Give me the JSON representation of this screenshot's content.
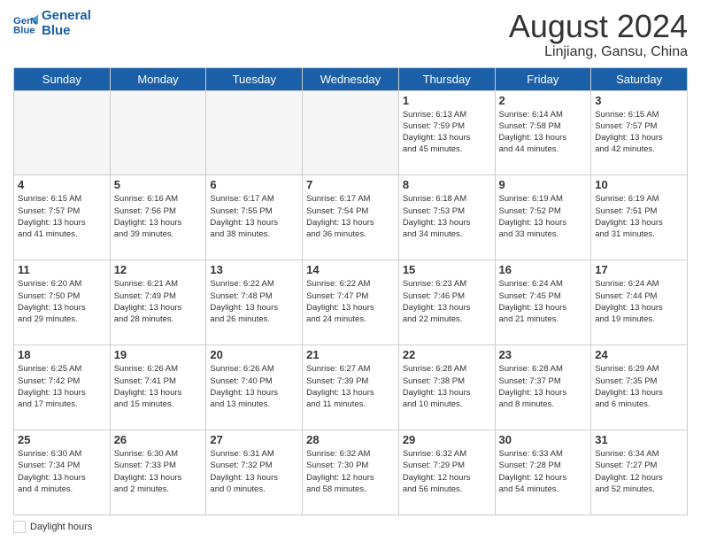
{
  "header": {
    "logo_line1": "General",
    "logo_line2": "Blue",
    "month_year": "August 2024",
    "location": "Linjiang, Gansu, China"
  },
  "weekdays": [
    "Sunday",
    "Monday",
    "Tuesday",
    "Wednesday",
    "Thursday",
    "Friday",
    "Saturday"
  ],
  "weeks": [
    [
      {
        "day": "",
        "info": ""
      },
      {
        "day": "",
        "info": ""
      },
      {
        "day": "",
        "info": ""
      },
      {
        "day": "",
        "info": ""
      },
      {
        "day": "1",
        "info": "Sunrise: 6:13 AM\nSunset: 7:59 PM\nDaylight: 13 hours\nand 45 minutes."
      },
      {
        "day": "2",
        "info": "Sunrise: 6:14 AM\nSunset: 7:58 PM\nDaylight: 13 hours\nand 44 minutes."
      },
      {
        "day": "3",
        "info": "Sunrise: 6:15 AM\nSunset: 7:57 PM\nDaylight: 13 hours\nand 42 minutes."
      }
    ],
    [
      {
        "day": "4",
        "info": "Sunrise: 6:15 AM\nSunset: 7:57 PM\nDaylight: 13 hours\nand 41 minutes."
      },
      {
        "day": "5",
        "info": "Sunrise: 6:16 AM\nSunset: 7:56 PM\nDaylight: 13 hours\nand 39 minutes."
      },
      {
        "day": "6",
        "info": "Sunrise: 6:17 AM\nSunset: 7:55 PM\nDaylight: 13 hours\nand 38 minutes."
      },
      {
        "day": "7",
        "info": "Sunrise: 6:17 AM\nSunset: 7:54 PM\nDaylight: 13 hours\nand 36 minutes."
      },
      {
        "day": "8",
        "info": "Sunrise: 6:18 AM\nSunset: 7:53 PM\nDaylight: 13 hours\nand 34 minutes."
      },
      {
        "day": "9",
        "info": "Sunrise: 6:19 AM\nSunset: 7:52 PM\nDaylight: 13 hours\nand 33 minutes."
      },
      {
        "day": "10",
        "info": "Sunrise: 6:19 AM\nSunset: 7:51 PM\nDaylight: 13 hours\nand 31 minutes."
      }
    ],
    [
      {
        "day": "11",
        "info": "Sunrise: 6:20 AM\nSunset: 7:50 PM\nDaylight: 13 hours\nand 29 minutes."
      },
      {
        "day": "12",
        "info": "Sunrise: 6:21 AM\nSunset: 7:49 PM\nDaylight: 13 hours\nand 28 minutes."
      },
      {
        "day": "13",
        "info": "Sunrise: 6:22 AM\nSunset: 7:48 PM\nDaylight: 13 hours\nand 26 minutes."
      },
      {
        "day": "14",
        "info": "Sunrise: 6:22 AM\nSunset: 7:47 PM\nDaylight: 13 hours\nand 24 minutes."
      },
      {
        "day": "15",
        "info": "Sunrise: 6:23 AM\nSunset: 7:46 PM\nDaylight: 13 hours\nand 22 minutes."
      },
      {
        "day": "16",
        "info": "Sunrise: 6:24 AM\nSunset: 7:45 PM\nDaylight: 13 hours\nand 21 minutes."
      },
      {
        "day": "17",
        "info": "Sunrise: 6:24 AM\nSunset: 7:44 PM\nDaylight: 13 hours\nand 19 minutes."
      }
    ],
    [
      {
        "day": "18",
        "info": "Sunrise: 6:25 AM\nSunset: 7:42 PM\nDaylight: 13 hours\nand 17 minutes."
      },
      {
        "day": "19",
        "info": "Sunrise: 6:26 AM\nSunset: 7:41 PM\nDaylight: 13 hours\nand 15 minutes."
      },
      {
        "day": "20",
        "info": "Sunrise: 6:26 AM\nSunset: 7:40 PM\nDaylight: 13 hours\nand 13 minutes."
      },
      {
        "day": "21",
        "info": "Sunrise: 6:27 AM\nSunset: 7:39 PM\nDaylight: 13 hours\nand 11 minutes."
      },
      {
        "day": "22",
        "info": "Sunrise: 6:28 AM\nSunset: 7:38 PM\nDaylight: 13 hours\nand 10 minutes."
      },
      {
        "day": "23",
        "info": "Sunrise: 6:28 AM\nSunset: 7:37 PM\nDaylight: 13 hours\nand 8 minutes."
      },
      {
        "day": "24",
        "info": "Sunrise: 6:29 AM\nSunset: 7:35 PM\nDaylight: 13 hours\nand 6 minutes."
      }
    ],
    [
      {
        "day": "25",
        "info": "Sunrise: 6:30 AM\nSunset: 7:34 PM\nDaylight: 13 hours\nand 4 minutes."
      },
      {
        "day": "26",
        "info": "Sunrise: 6:30 AM\nSunset: 7:33 PM\nDaylight: 13 hours\nand 2 minutes."
      },
      {
        "day": "27",
        "info": "Sunrise: 6:31 AM\nSunset: 7:32 PM\nDaylight: 13 hours\nand 0 minutes."
      },
      {
        "day": "28",
        "info": "Sunrise: 6:32 AM\nSunset: 7:30 PM\nDaylight: 12 hours\nand 58 minutes."
      },
      {
        "day": "29",
        "info": "Sunrise: 6:32 AM\nSunset: 7:29 PM\nDaylight: 12 hours\nand 56 minutes."
      },
      {
        "day": "30",
        "info": "Sunrise: 6:33 AM\nSunset: 7:28 PM\nDaylight: 12 hours\nand 54 minutes."
      },
      {
        "day": "31",
        "info": "Sunrise: 6:34 AM\nSunset: 7:27 PM\nDaylight: 12 hours\nand 52 minutes."
      }
    ]
  ],
  "legend": {
    "daylight_label": "Daylight hours"
  }
}
